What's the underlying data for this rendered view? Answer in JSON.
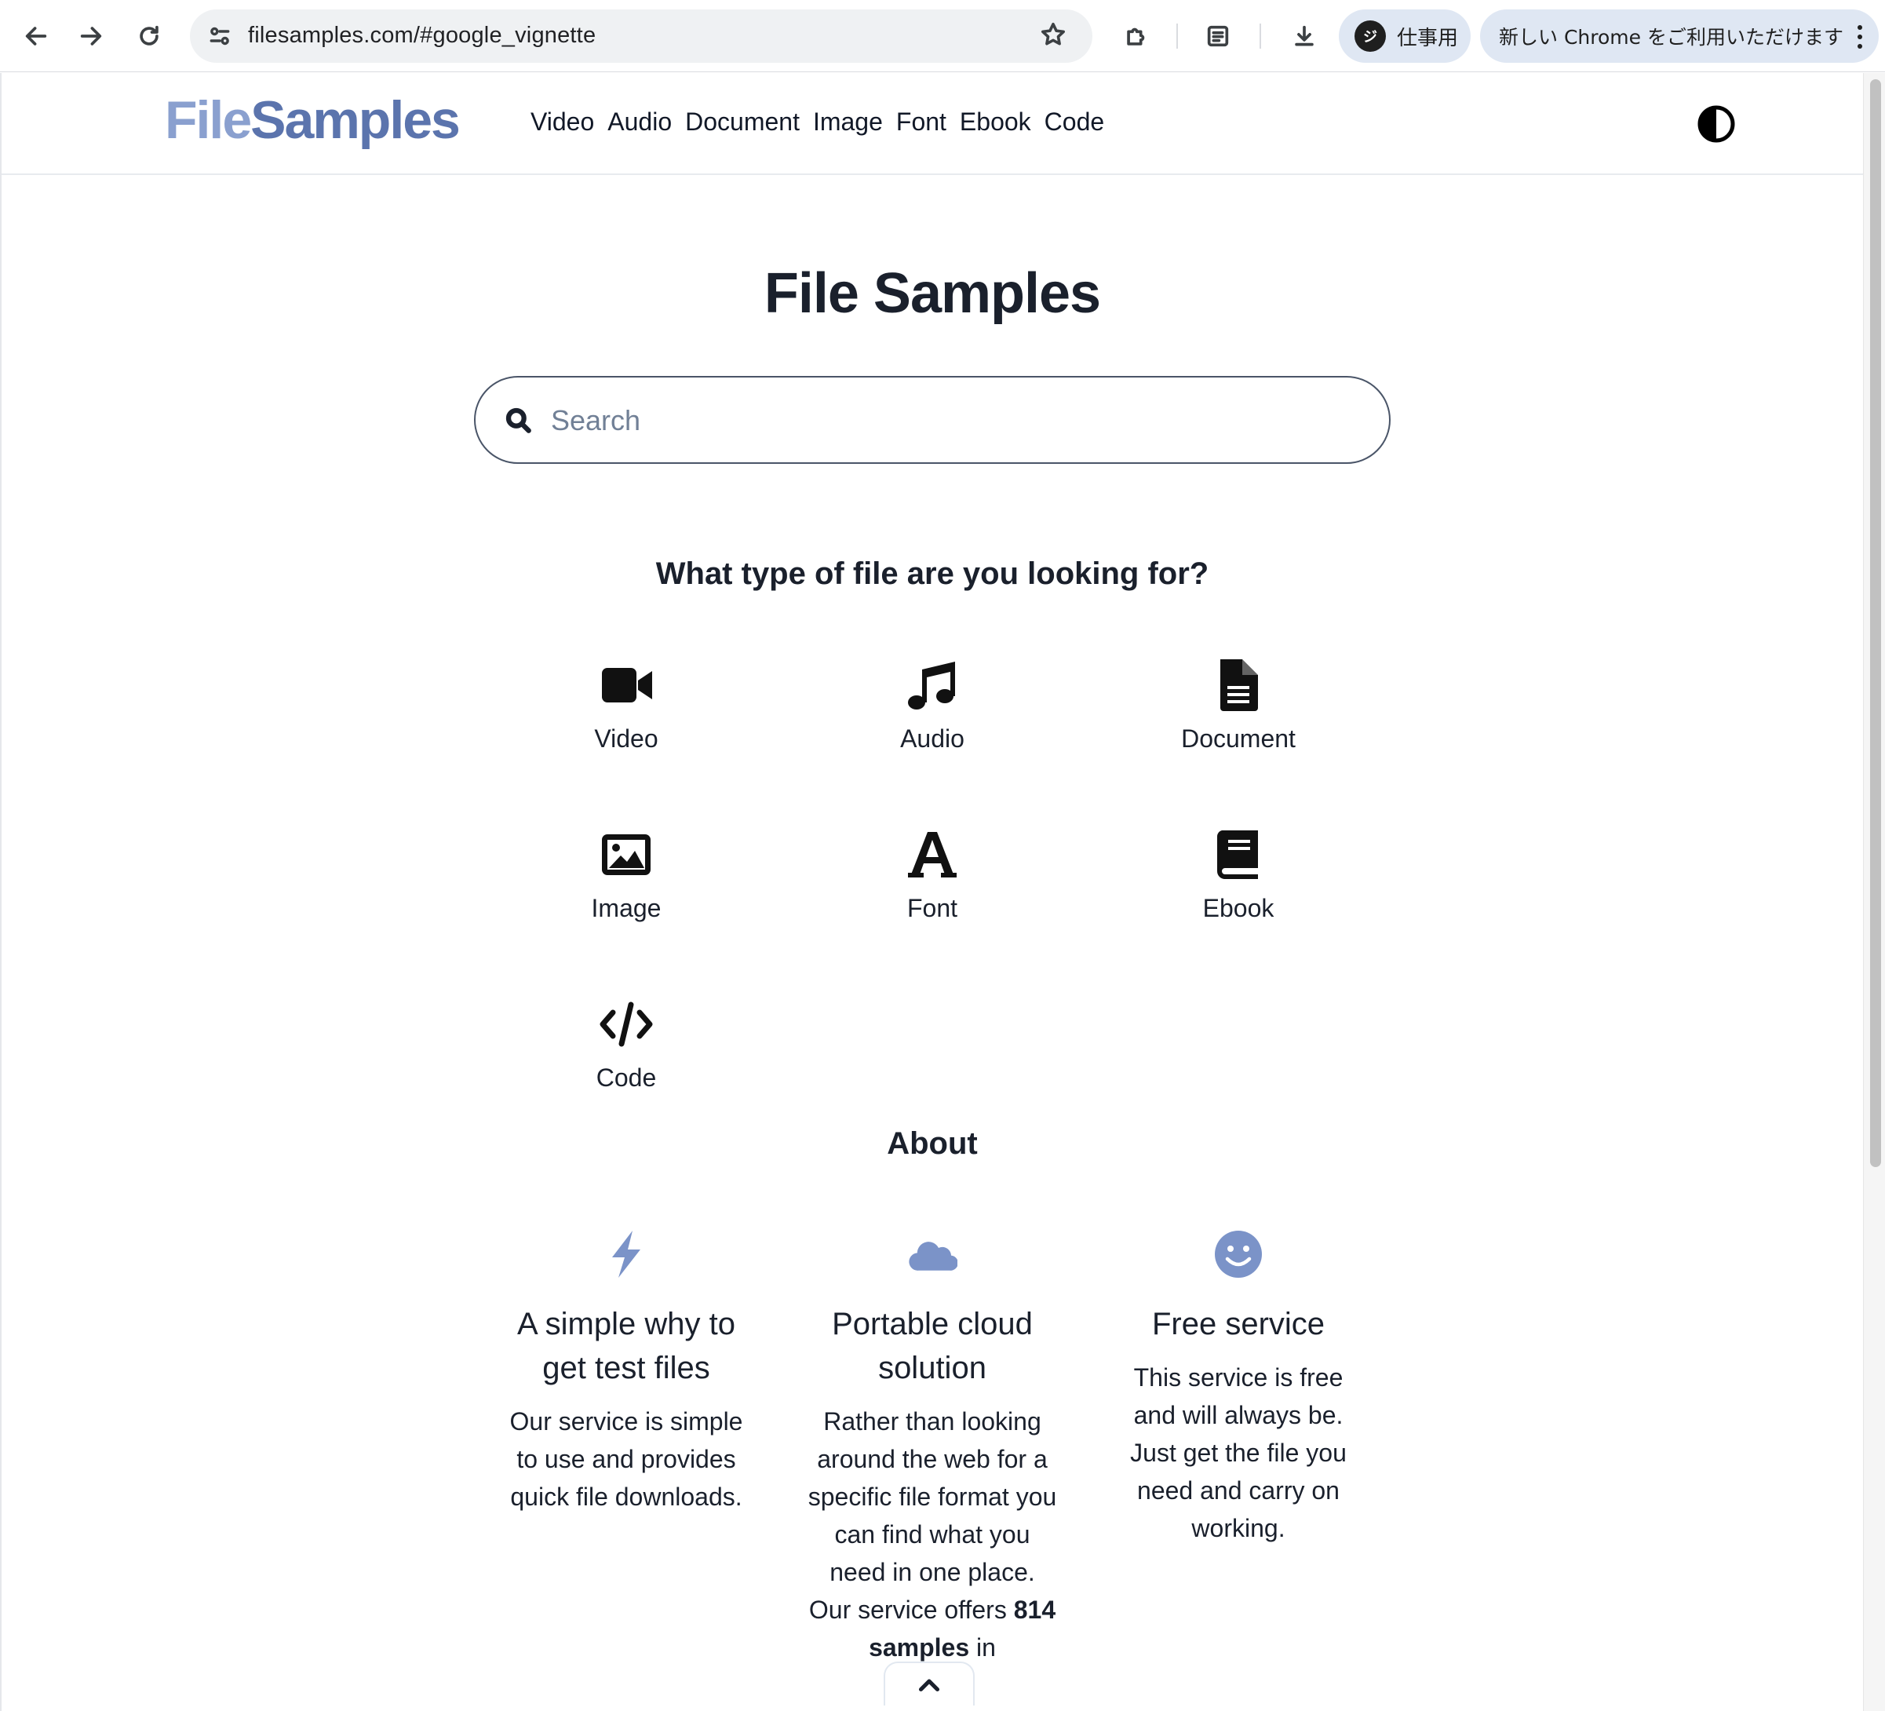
{
  "browser": {
    "url": "filesamples.com/#google_vignette",
    "profile_initial": "ジ",
    "profile_label": "仕事用",
    "update_label": "新しい Chrome をご利用いただけます"
  },
  "header": {
    "logo_part1": "File",
    "logo_part2": "Samples",
    "nav": [
      "Video",
      "Audio",
      "Document",
      "Image",
      "Font",
      "Ebook",
      "Code"
    ]
  },
  "hero": {
    "title": "File Samples",
    "search_placeholder": "Search",
    "question": "What type of file are you looking for?"
  },
  "file_types": [
    {
      "label": "Video",
      "icon": "video-camera-icon"
    },
    {
      "label": "Audio",
      "icon": "music-note-icon"
    },
    {
      "label": "Document",
      "icon": "document-icon"
    },
    {
      "label": "Image",
      "icon": "image-icon"
    },
    {
      "label": "Font",
      "icon": "font-icon"
    },
    {
      "label": "Ebook",
      "icon": "book-icon"
    },
    {
      "label": "Code",
      "icon": "code-icon"
    }
  ],
  "about": {
    "title": "About",
    "features": [
      {
        "icon": "lightning-icon",
        "title": "A simple why to get test files",
        "text": "Our service is simple to use and provides quick file downloads."
      },
      {
        "icon": "cloud-icon",
        "title": "Portable cloud solution",
        "text_before": "Rather than looking around the web for a specific file format you can find what you need in one place. Our service offers ",
        "count": "814",
        "text_bold_rest": " samples",
        "text_after": " in"
      },
      {
        "icon": "smiley-icon",
        "title": "Free service",
        "text": "This service is free and will always be. Just get the file you need and carry on working."
      }
    ]
  },
  "colors": {
    "logo_light": "#8aa0cf",
    "logo_dark": "#5b74ad",
    "feature_icon": "#7b93c8",
    "text": "#1a202c"
  }
}
